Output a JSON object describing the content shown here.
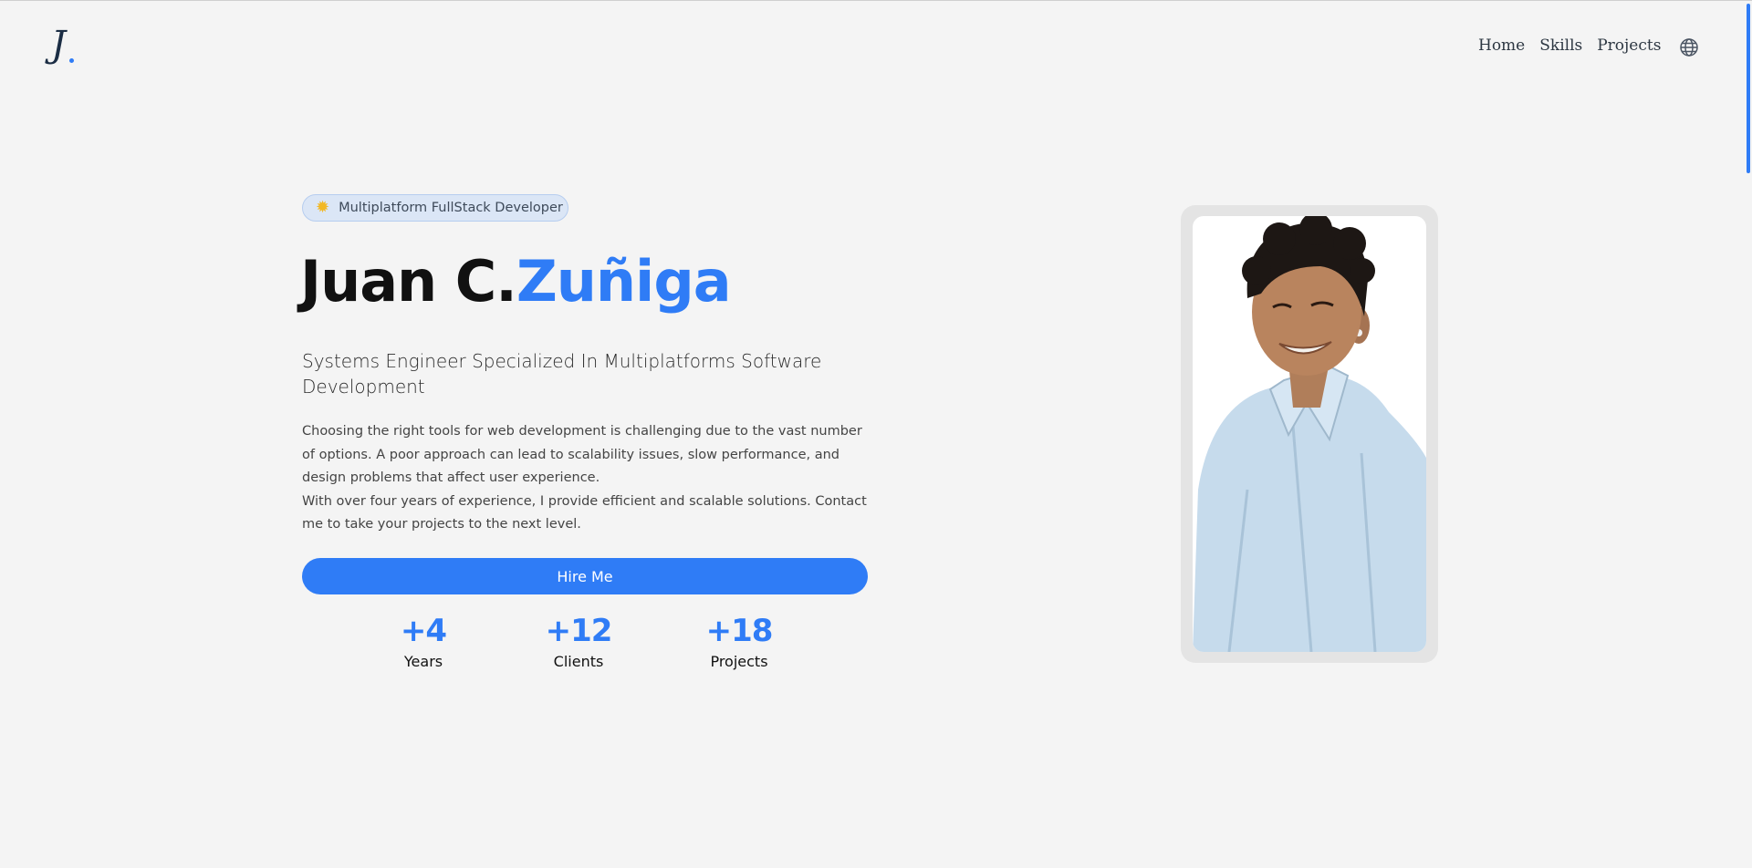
{
  "header": {
    "logo_letter": "J",
    "nav": [
      {
        "label": "Home"
      },
      {
        "label": "Skills"
      },
      {
        "label": "Projects"
      }
    ],
    "language_icon": "globe-icon"
  },
  "hero": {
    "badge_icon": "star-icon",
    "badge_text": "Multiplatform FullStack Developer",
    "name_main": "Juan C.",
    "name_accent": "Zuñiga",
    "subtitle": "Systems Engineer Specialized In Multiplatforms Software Development",
    "description_1": "Choosing the right tools for web development is challenging due to the vast number of options. A poor approach can lead to scalability issues, slow performance, and design problems that affect user experience.",
    "description_2": "With over four years of experience, I provide efficient and scalable solutions. Contact me to take your projects to the next level.",
    "cta_label": "Hire Me",
    "stats": [
      {
        "value": "+4",
        "label": "Years"
      },
      {
        "value": "+12",
        "label": "Clients"
      },
      {
        "value": "+18",
        "label": "Projects"
      }
    ]
  },
  "colors": {
    "accent": "#2f7cf6",
    "background": "#f4f4f4",
    "text_dark": "#111111"
  }
}
